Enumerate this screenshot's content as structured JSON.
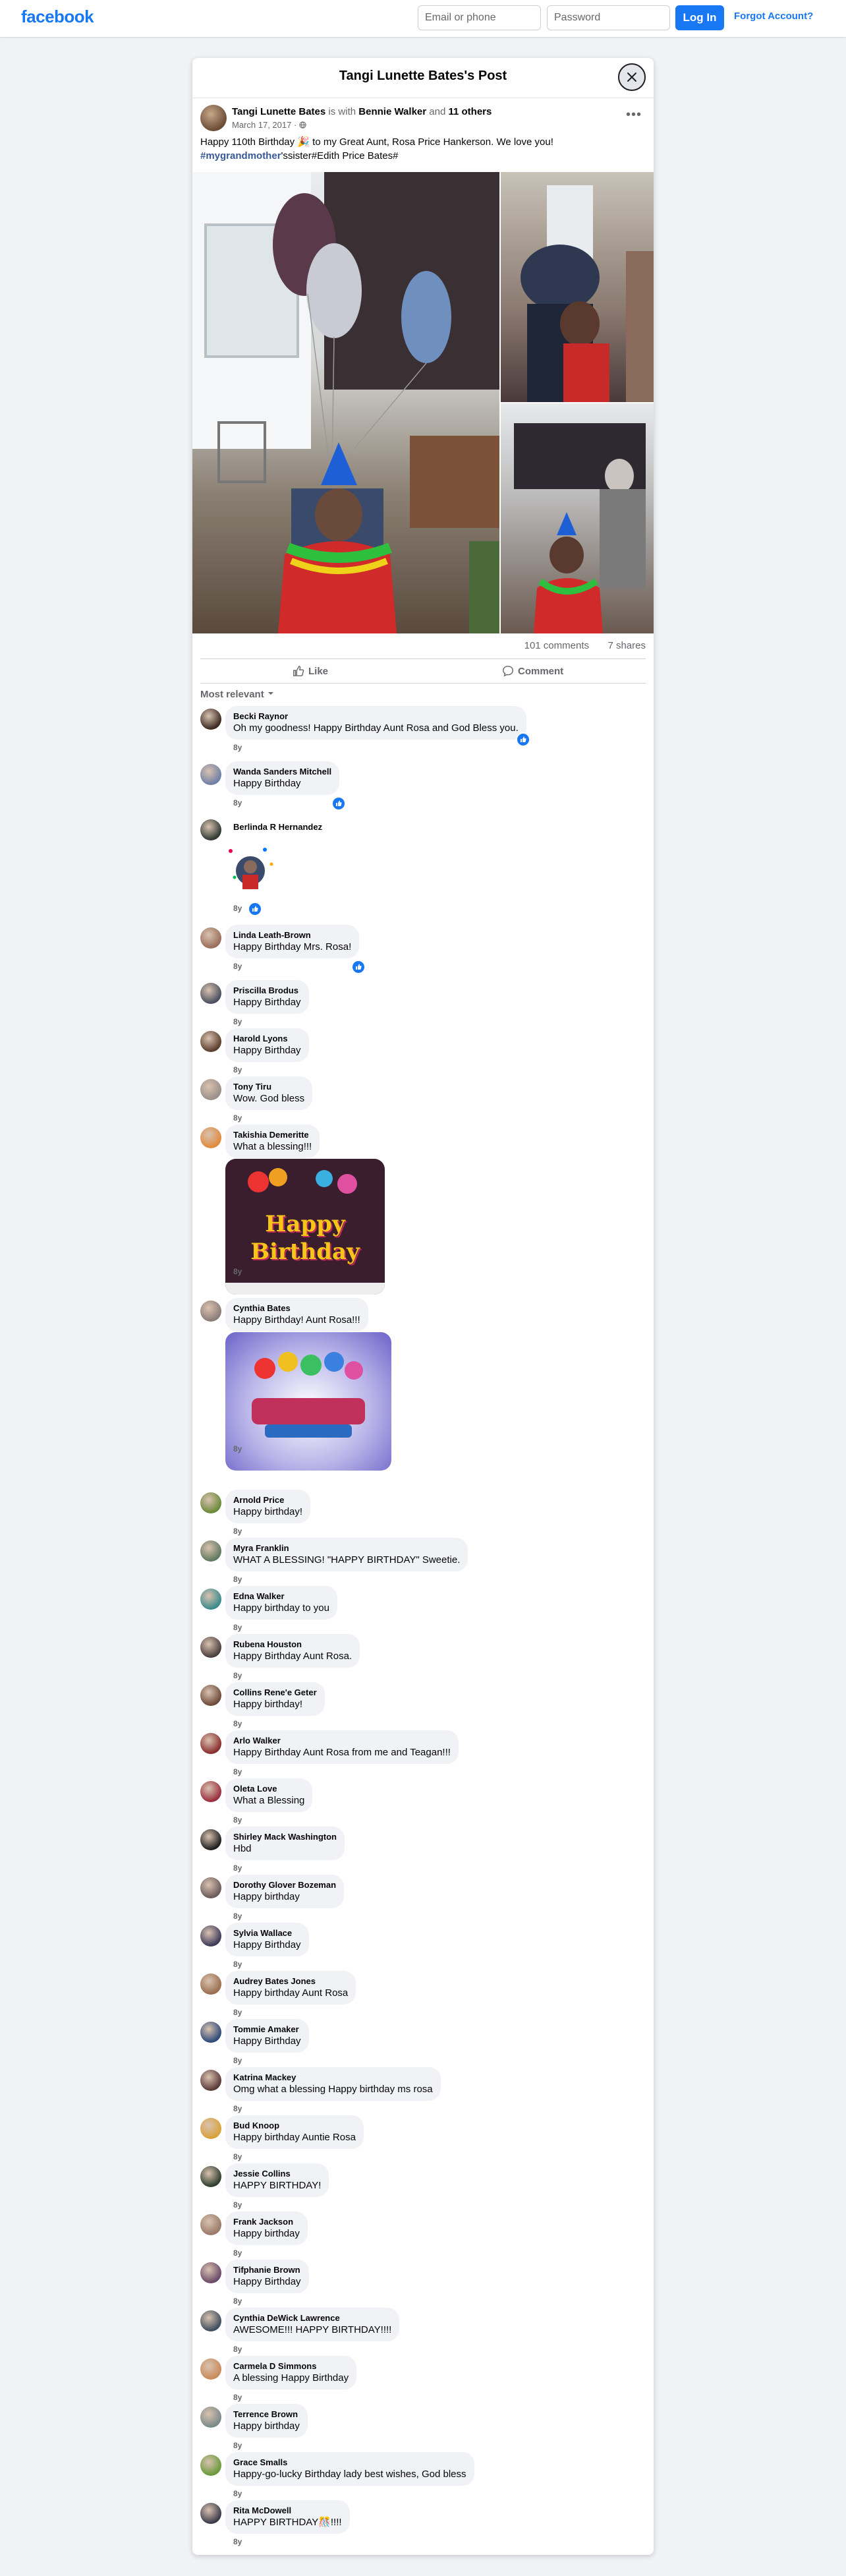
{
  "topbar": {
    "logo": "facebook",
    "email_placeholder": "Email or phone",
    "password_placeholder": "Password",
    "login_label": "Log In",
    "forgot_label": "Forgot Account?"
  },
  "post": {
    "dialog_title": "Tangi Lunette Bates's Post",
    "author": "Tangi Lunette Bates",
    "with_text": "is with",
    "with_person": "Bennie Walker",
    "and_text": "and",
    "others": "11 others",
    "date": "March 17, 2017 ·",
    "text_line1": "Happy 110th Birthday 🎉 to my Great Aunt,  Rosa Price Hankerson. We love you!",
    "hashtag": "#mygrandmother",
    "text_line2_rest": "'ssister#Edith Price Bates#",
    "comments_count": "101 comments",
    "shares_count": "7 shares",
    "like_label": "Like",
    "comment_label": "Comment",
    "sort_label": "Most relevant"
  },
  "comments": [
    {
      "name": "Becki Raynor",
      "text": "Oh my goodness! Happy Birthday Aunt Rosa and God Bless you.",
      "meta": "8y",
      "color": "#3b2a22"
    },
    {
      "name": "Wanda Sanders Mitchell",
      "text": "Happy Birthday",
      "meta": "8y",
      "color": "#6f7fa6"
    },
    {
      "name": "Berlinda R Hernandez",
      "text": "",
      "meta": "8y",
      "color": "#2f3a33"
    },
    {
      "name": "Linda Leath-Brown",
      "text": "Happy Birthday Mrs. Rosa!",
      "meta": "8y",
      "color": "#9a6e5a"
    },
    {
      "name": "Priscilla Brodus",
      "text": "Happy Birthday",
      "meta": "8y",
      "color": "#4a4f5e"
    },
    {
      "name": "Harold Lyons",
      "text": "Happy Birthday",
      "meta": "8y",
      "color": "#5a3e2e"
    },
    {
      "name": "Tony Tiru",
      "text": "Wow. God bless",
      "meta": "8y",
      "color": "#9a8f8a"
    },
    {
      "name": "Takishia Demeritte",
      "text": "What a blessing!!!",
      "meta": "8y",
      "color": "#e08a3c"
    },
    {
      "name": "Cynthia Bates",
      "text": "Happy Birthday! Aunt Rosa!!!",
      "meta": "8y",
      "color": "#8c7c78"
    },
    {
      "name": "Arnold Price",
      "text": "Happy birthday!",
      "meta": "8y",
      "color": "#6a8a3a"
    },
    {
      "name": "Myra Franklin",
      "text": "WHAT A BLESSING! \"HAPPY BIRTHDAY\" Sweetie.",
      "meta": "8y",
      "color": "#5f7a5f"
    },
    {
      "name": "Edna Walker",
      "text": "Happy birthday to you",
      "meta": "8y",
      "color": "#3a8a8a"
    },
    {
      "name": "Rubena Houston",
      "text": "Happy Birthday Aunt Rosa.",
      "meta": "8y",
      "color": "#4a3e3e"
    },
    {
      "name": "Collins Rene'e Geter",
      "text": "Happy birthday!",
      "meta": "8y",
      "color": "#6e4a3a"
    },
    {
      "name": "Arlo Walker",
      "text": "Happy Birthday Aunt Rosa from me and Teagan!!!",
      "meta": "8y",
      "color": "#8a2e2e"
    },
    {
      "name": "Oleta Love",
      "text": "What a Blessing",
      "meta": "8y",
      "color": "#9a2e3e"
    },
    {
      "name": "Shirley Mack Washington",
      "text": "Hbd",
      "meta": "8y",
      "color": "#1e1e1e"
    },
    {
      "name": "Dorothy Glover Bozeman",
      "text": "Happy birthday",
      "meta": "8y",
      "color": "#6a5a5a"
    },
    {
      "name": "Sylvia Wallace",
      "text": "Happy Birthday",
      "meta": "8y",
      "color": "#3e3a5a"
    },
    {
      "name": "Audrey Bates Jones",
      "text": "Happy birthday Aunt Rosa",
      "meta": "8y",
      "color": "#9a6e4e"
    },
    {
      "name": "Tommie Amaker",
      "text": "Happy Birthday",
      "meta": "8y",
      "color": "#2e4a7a"
    },
    {
      "name": "Katrina Mackey",
      "text": "Omg what a blessing Happy birthday ms rosa",
      "meta": "8y",
      "color": "#5a3a3a"
    },
    {
      "name": "Bud Knoop",
      "text": "Happy birthday Auntie Rosa",
      "meta": "8y",
      "color": "#d9a23a"
    },
    {
      "name": "Jessie Collins",
      "text": "HAPPY BIRTHDAY!",
      "meta": "8y",
      "color": "#2e3e2e"
    },
    {
      "name": "Frank Jackson",
      "text": "Happy birthday",
      "meta": "8y",
      "color": "#9a7a6a"
    },
    {
      "name": "Tifphanie Brown",
      "text": "Happy Birthday",
      "meta": "8y",
      "color": "#6a4a6a"
    },
    {
      "name": "Cynthia DeWick Lawrence",
      "text": "AWESOME!!! HAPPY BIRTHDAY!!!!",
      "meta": "8y",
      "color": "#3e4e5e"
    },
    {
      "name": "Carmela D Simmons",
      "text": "A blessing Happy Birthday",
      "meta": "8y",
      "color": "#c98a5a"
    },
    {
      "name": "Terrence Brown",
      "text": "Happy birthday",
      "meta": "8y",
      "color": "#7a8a8a"
    },
    {
      "name": "Grace Smalls",
      "text": "Happy-go-lucky Birthday lady best wishes, God bless",
      "meta": "8y",
      "color": "#6a9a3a"
    },
    {
      "name": "Rita McDowell",
      "text": "HAPPY BIRTHDAY🎊!!!!",
      "meta": "8y",
      "color": "#3a3a4a"
    }
  ],
  "gif_text": "Happy Birthday",
  "colors": {
    "brand": "#1877f2",
    "bg": "#f0f2f5",
    "muted": "#65676b"
  }
}
